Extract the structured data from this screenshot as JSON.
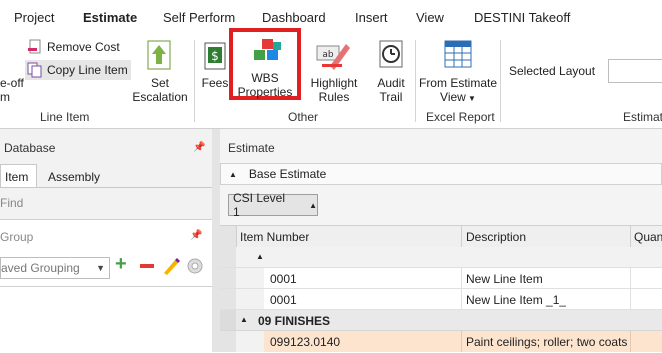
{
  "menu": {
    "tabs": [
      "Project",
      "Estimate",
      "Self Perform",
      "Dashboard",
      "Insert",
      "View",
      "DESTINI Takeoff"
    ],
    "active": "Estimate"
  },
  "ribbon": {
    "line_item": {
      "cut_label_top": "e-off",
      "cut_label_bottom": "m",
      "remove_cost": "Remove Cost",
      "copy_line_item": "Copy Line Item",
      "set_escalation_1": "Set",
      "set_escalation_2": "Escalation",
      "group_label": "Line Item"
    },
    "other": {
      "fees": "Fees",
      "wbs_1": "WBS",
      "wbs_2": "Properties",
      "highlight_1": "Highlight",
      "highlight_2": "Rules",
      "audit_1": "Audit",
      "audit_2": "Trail",
      "group_label": "Other"
    },
    "excel": {
      "from_estimate_1": "From Estimate",
      "from_estimate_2": "View",
      "group_label": "Excel Report"
    },
    "layout": {
      "selected_layout_label": "Selected Layout",
      "group_label_partial": "Estimat"
    },
    "highlight_color": "#e02020"
  },
  "left_pane": {
    "title": "Database",
    "tabs": [
      "Item",
      "Assembly"
    ],
    "find_label": "Find",
    "group_title": "Group",
    "grouping_select": "aved Grouping"
  },
  "right_pane": {
    "title": "Estimate",
    "base_estimate": "Base Estimate",
    "csi_level": "CSI Level 1",
    "columns": [
      "Item Number",
      "Description",
      "Quan"
    ],
    "rows": [
      {
        "type": "group-empty",
        "item": "",
        "desc": ""
      },
      {
        "type": "item",
        "item": "0001",
        "desc": "New Line Item"
      },
      {
        "type": "item",
        "item": "0001",
        "desc": "New Line Item _1_"
      },
      {
        "type": "section",
        "item": "09 FINISHES",
        "desc": ""
      },
      {
        "type": "highlight",
        "item": "099123.0140",
        "desc": "Paint ceilings; roller; two coats"
      }
    ]
  }
}
